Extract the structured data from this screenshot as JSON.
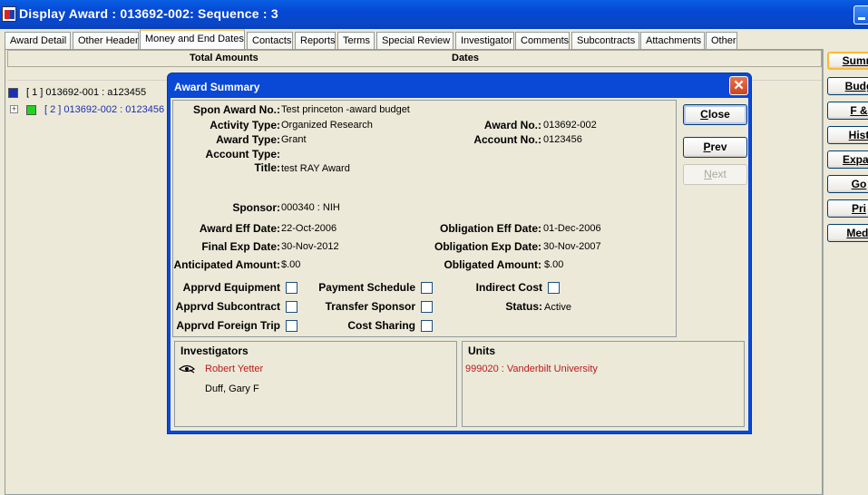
{
  "window": {
    "title": "Display Award : 013692-002: Sequence : 3"
  },
  "tabs": [
    {
      "label": "Award Detail",
      "active": false
    },
    {
      "label": "Other Header",
      "active": false
    },
    {
      "label": "Money and End Dates",
      "active": true
    },
    {
      "label": "Contacts",
      "active": false
    },
    {
      "label": "Reports",
      "active": false
    },
    {
      "label": "Terms",
      "active": false
    },
    {
      "label": "Special Review",
      "active": false
    },
    {
      "label": "Investigator",
      "active": false
    },
    {
      "label": "Comments",
      "active": false
    },
    {
      "label": "Subcontracts",
      "active": false
    },
    {
      "label": "Attachments",
      "active": false
    },
    {
      "label": "Other",
      "active": false
    }
  ],
  "table": {
    "col_total": "Total Amounts",
    "col_dates": "Dates"
  },
  "tree": {
    "item1": "[ 1 ] 013692-001 : a123455",
    "item2": "[ 2 ] 013692-002 : 0123456",
    "expander": "+"
  },
  "side_buttons": [
    "Summ",
    "Budg",
    "F &",
    "Hist",
    "Expan",
    "Go",
    "Pri",
    "Medi"
  ],
  "dialog": {
    "title": "Award Summary",
    "labels": {
      "spon_award_no": "Spon Award No.:",
      "activity_type": "Activity Type:",
      "award_type": "Award Type:",
      "account_type": "Account Type:",
      "title": "Title:",
      "award_no": "Award No.:",
      "account_no": "Account No.:",
      "sponsor": "Sponsor:",
      "award_eff_date": "Award Eff Date:",
      "final_exp_date": "Final Exp Date:",
      "anticipated_amount": "Anticipated Amount:",
      "obligation_eff_date": "Obligation Eff Date:",
      "obligation_exp_date": "Obligation Exp Date:",
      "obligated_amount": "Obligated Amount:",
      "apprvd_equipment": "Apprvd Equipment",
      "apprvd_subcontract": "Apprvd Subcontract",
      "apprvd_foreign_trip": "Apprvd Foreign Trip",
      "payment_schedule": "Payment Schedule",
      "transfer_sponsor": "Transfer Sponsor",
      "cost_sharing": "Cost Sharing",
      "indirect_cost": "Indirect Cost",
      "status": "Status:"
    },
    "values": {
      "spon_award_no": "Test  princeton -award budget",
      "activity_type": "Organized Research",
      "award_type": "Grant",
      "account_type": "",
      "title": "test RAY Award",
      "award_no": "013692-002",
      "account_no": "0123456",
      "sponsor": "000340 : NIH",
      "award_eff_date": "22-Oct-2006",
      "final_exp_date": "30-Nov-2012",
      "anticipated_amount": "$.00",
      "obligation_eff_date": "01-Dec-2006",
      "obligation_exp_date": "30-Nov-2007",
      "obligated_amount": "$.00",
      "status": "Active"
    },
    "buttons": {
      "close_u": "C",
      "close_rest": "lose",
      "prev_u": "P",
      "prev_rest": "rev",
      "next_u": "N",
      "next_rest": "ext"
    },
    "investigators": {
      "heading": "Investigators",
      "items": [
        "Robert Yetter",
        "Duff, Gary F"
      ]
    },
    "units": {
      "heading": "Units",
      "items": [
        "999020  :  Vanderbilt University"
      ]
    }
  }
}
